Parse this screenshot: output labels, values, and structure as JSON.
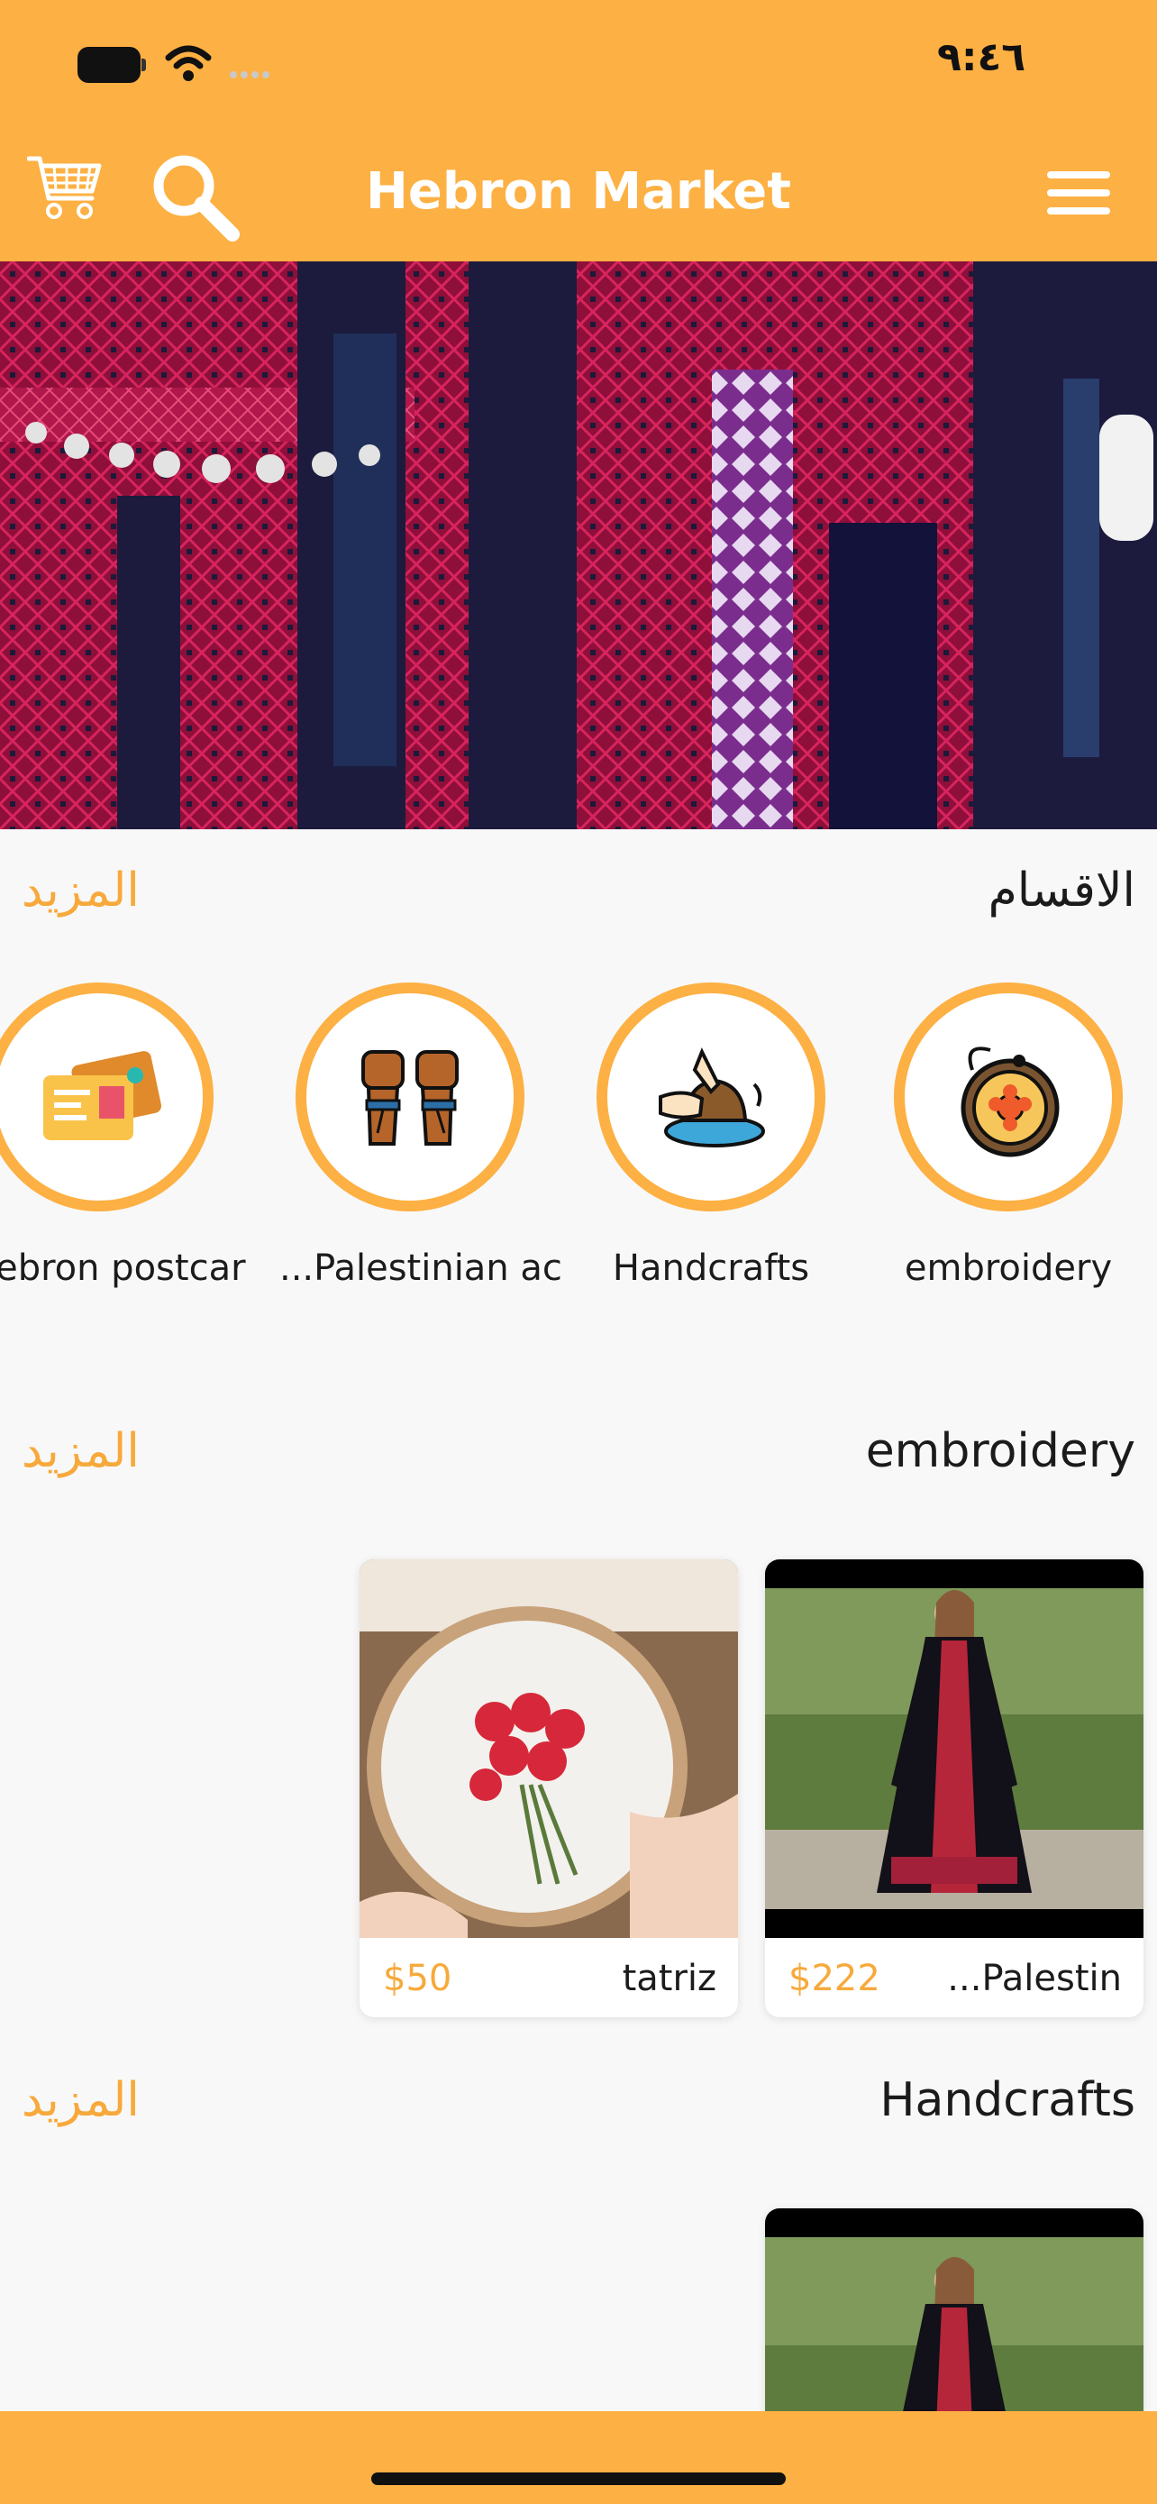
{
  "status_bar": {
    "time": "٩:٤٦"
  },
  "header": {
    "title": "Hebron Market"
  },
  "categories_section": {
    "title": "الاقسام",
    "more": "المزيد",
    "items": [
      {
        "label": "embroidery",
        "icon": "embroidery-hoop-icon"
      },
      {
        "label": "Handcrafts",
        "icon": "pottery-wheel-icon"
      },
      {
        "label": "...Palestinian ac",
        "icon": "bracelet-fists-icon"
      },
      {
        "label": "Hebron postcar",
        "icon": "postcards-icon"
      }
    ]
  },
  "embroidery_section": {
    "title": "embroidery",
    "more": "المزيد",
    "products": [
      {
        "name": "...Palestin",
        "price": "$222",
        "image": "dress-photo"
      },
      {
        "name": "tatriz",
        "price": "$50",
        "image": "embroidery-hoop-photo"
      }
    ]
  },
  "handcrafts_section": {
    "title": "Handcrafts",
    "more": "المزيد"
  },
  "colors": {
    "brand": "#fdb043",
    "accent_text": "#f7a93b",
    "background": "#f8f8f8"
  }
}
